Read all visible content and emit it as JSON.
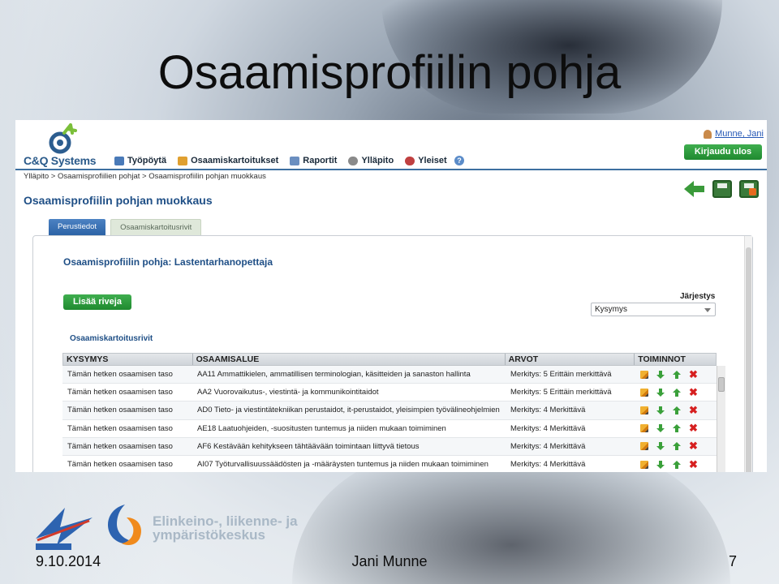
{
  "slide": {
    "title": "Osaamisprofiilin pohja",
    "date": "9.10.2014",
    "author": "Jani Munne",
    "page_number": "7",
    "ely_text_line1": "Elinkeino-, liikenne- ja",
    "ely_text_line2": "ympäristökeskus"
  },
  "app": {
    "brand": "C&Q Systems",
    "nav": [
      {
        "label": "Työpöytä",
        "icon": "desktop-icon",
        "color": "#4a7ab8"
      },
      {
        "label": "Osaamiskartoitukset",
        "icon": "document-icon",
        "color": "#e0a030"
      },
      {
        "label": "Raportit",
        "icon": "report-icon",
        "color": "#6b8fc0"
      },
      {
        "label": "Ylläpito",
        "icon": "gear-icon",
        "color": "#8a8a8a"
      },
      {
        "label": "Yleiset",
        "icon": "people-icon",
        "color": "#c04040"
      }
    ],
    "user_label": "Munne, Jani",
    "logout_label": "Kirjaudu ulos",
    "breadcrumb": "Ylläpito > Osaamisprofiilien pohjat > Osaamisprofiilin pohjan muokkaus",
    "page_heading": "Osaamisprofiilin pohjan muokkaus",
    "tabs": [
      {
        "label": "Perustiedot",
        "active": true
      },
      {
        "label": "Osaamiskartoitusrivit",
        "active": false
      }
    ],
    "panel_title": "Osaamisprofiilin pohja: Lastentarhanopettaja",
    "add_rows_label": "Lisää riveja",
    "sort_label": "Järjestys",
    "sort_value": "Kysymys",
    "sub_heading": "Osaamiskartoitusrivit",
    "columns": [
      "KYSYMYS",
      "OSAAMISALUE",
      "ARVOT",
      "TOIMINNOT"
    ],
    "rows": [
      {
        "q": "Tämän hetken osaamisen taso",
        "area": "AA11 Ammattikielen, ammatillisen terminologian, käsitteiden ja sanaston hallinta",
        "value": "Merkitys: 5 Erittäin merkittävä"
      },
      {
        "q": "Tämän hetken osaamisen taso",
        "area": "AA2 Vuorovaikutus-, viestintä- ja kommunikointitaidot",
        "value": "Merkitys: 5 Erittäin merkittävä"
      },
      {
        "q": "Tämän hetken osaamisen taso",
        "area": "AD0 Tieto- ja viestintätekniikan perustaidot, it-perustaidot, yleisimpien työvälineohjelmien",
        "value": "Merkitys: 4 Merkittävä"
      },
      {
        "q": "Tämän hetken osaamisen taso",
        "area": "AE18 Laatuohjeiden, -suositusten tuntemus ja niiden mukaan toimiminen",
        "value": "Merkitys: 4 Merkittävä"
      },
      {
        "q": "Tämän hetken osaamisen taso",
        "area": "AF6 Kestävään kehitykseen tähtäävään toimintaan liittyvä tietous",
        "value": "Merkitys: 4 Merkittävä"
      },
      {
        "q": "Tämän hetken osaamisen taso",
        "area": "AI07 Työturvallisuussäädösten ja -määräysten tuntemus ja niiden mukaan toimiminen",
        "value": "Merkitys: 4 Merkittävä"
      }
    ]
  }
}
